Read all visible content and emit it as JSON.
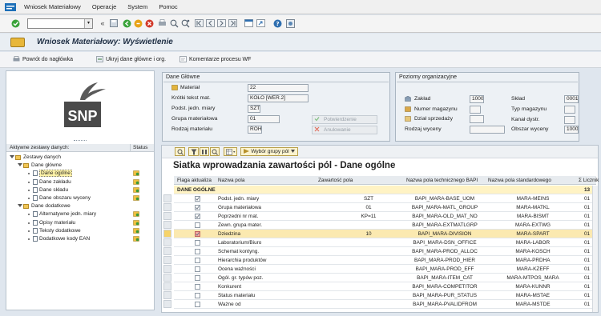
{
  "menu": [
    "Wniosek Materiałowy",
    "Operacje",
    "System",
    "Pomoc"
  ],
  "window_title": "Wniosek Materiałowy: Wyświetlenie",
  "app_toolbar": {
    "back": "Powrót do nagłówka",
    "hide": "Ukryj dane główne i org.",
    "comments": "Komentarze procesu WF"
  },
  "left": {
    "logo_text": "SNP",
    "tree_header": "Aktywne zestawy danych:",
    "status_header": "Status",
    "tree": [
      {
        "label": "Zestawy danych",
        "level": 0,
        "type": "folder"
      },
      {
        "label": "Dane główne",
        "level": 1,
        "type": "folder"
      },
      {
        "label": "Dane ogólne",
        "level": 2,
        "type": "doc",
        "status": true,
        "selected": true
      },
      {
        "label": "Dane zakładu",
        "level": 2,
        "type": "doc",
        "status": true
      },
      {
        "label": "Dane składu",
        "level": 2,
        "type": "doc",
        "status": true
      },
      {
        "label": "Dane obszaru wyceny",
        "level": 2,
        "type": "doc",
        "status": true
      },
      {
        "label": "Dane dodatkowe",
        "level": 1,
        "type": "folder"
      },
      {
        "label": "Alternatywne jedn. miary",
        "level": 2,
        "type": "doc",
        "status": true
      },
      {
        "label": "Opisy materiału",
        "level": 2,
        "type": "doc",
        "status": true
      },
      {
        "label": "Teksty dodatkowe",
        "level": 2,
        "type": "doc",
        "status": true
      },
      {
        "label": "Dodatkowe kody EAN",
        "level": 2,
        "type": "doc",
        "status": true
      }
    ]
  },
  "main_data": {
    "title": "Dane Główne",
    "material_label": "Materiał",
    "material_value": "22",
    "short_text_label": "Krótki tekst mat.",
    "short_text_value": "KOŁO [WER.2]",
    "base_uom_label": "Podst. jedn. miary",
    "base_uom_value": "SZT",
    "mat_group_label": "Grupa materiałowa",
    "mat_group_value": "01",
    "mat_type_label": "Rodzaj materiału",
    "mat_type_value": "ROH",
    "confirm_btn": "Potwierdzenie",
    "cancel_btn": "Anulowanie"
  },
  "org_levels": {
    "title": "Poziomy organizacyjne",
    "plant_label": "Zakład",
    "plant_value": "1000",
    "storage_label": "Skład",
    "storage_value": "0001",
    "warehouse_label": "Numer magazynu",
    "warehouse_type_label": "Typ magazynu",
    "sales_org_label": "Dział sprzedaży",
    "dist_channel_label": "Kanał dystr.",
    "valuation_type_label": "Rodzaj wyceny",
    "valuation_area_label": "Obszar wyceny",
    "valuation_area_value": "1000"
  },
  "grid": {
    "select_group_btn": "Wybór grupy pól",
    "title": "Siatka wprowadzania zawartości pól - Dane ogólne",
    "columns": [
      "Flaga aktualiza",
      "Nazwa pola",
      "Zawartość pola",
      "Nazwa pola technicznego BAPI",
      "Nazwa pola standardowego",
      "Σ Licznik"
    ],
    "group_row": {
      "label": "DANE OGÓLNE",
      "count": "13"
    },
    "rows": [
      {
        "checked": true,
        "field": "Podst. jedn. miary",
        "value": "SZT",
        "bapi": "BAPI_MARA-BASE_UOM",
        "std": "MARA-MEINS",
        "count": "01"
      },
      {
        "checked": true,
        "field": "Grupa materiałowa",
        "value": "01",
        "bapi": "BAPI_MARA-MATL_GROUP",
        "std": "MARA-MATKL",
        "count": "01"
      },
      {
        "checked": true,
        "field": "Poprzedni nr mat.",
        "value": "KP=11",
        "bapi": "BAPI_MARA-OLD_MAT_NO",
        "std": "MARA-BISMT",
        "count": "01"
      },
      {
        "checked": false,
        "field": "Zewn. grupa mater.",
        "value": "",
        "bapi": "BAPI_MARA-EXTMATLGRP",
        "std": "MARA-EXTWG",
        "count": "01"
      },
      {
        "checked": true,
        "field": "Dziedzina",
        "value": "10",
        "bapi": "BAPI_MARA-DIVISION",
        "std": "MARA-SPART",
        "count": "01",
        "highlight": true
      },
      {
        "checked": false,
        "field": "Laboratorium/Biuro",
        "value": "",
        "bapi": "BAPI_MARA-DSN_OFFICE",
        "std": "MARA-LABOR",
        "count": "01"
      },
      {
        "checked": false,
        "field": "Schemat kontyng.",
        "value": "",
        "bapi": "BAPI_MARA-PROD_ALLOC",
        "std": "MARA-KOSCH",
        "count": "01"
      },
      {
        "checked": false,
        "field": "Hierarchia produktów",
        "value": "",
        "bapi": "BAPI_MARA-PROD_HIER",
        "std": "MARA-PRDHA",
        "count": "01"
      },
      {
        "checked": false,
        "field": "Ocena ważności",
        "value": "",
        "bapi": "BAPI_MARA-PROD_EFF",
        "std": "MARA-KZEFF",
        "count": "01"
      },
      {
        "checked": false,
        "field": "Ogól. gr. typów poz.",
        "value": "",
        "bapi": "BAPI_MARA-ITEM_CAT",
        "std": "MARA-MTPOS_MARA",
        "count": "01"
      },
      {
        "checked": false,
        "field": "Konkurent",
        "value": "",
        "bapi": "BAPI_MARA-COMPETITOR",
        "std": "MARA-KUNNR",
        "count": "01"
      },
      {
        "checked": false,
        "field": "Status materiału",
        "value": "",
        "bapi": "BAPI_MARA-PUR_STATUS",
        "std": "MARA-MSTAE",
        "count": "01"
      },
      {
        "checked": false,
        "field": "Ważne od",
        "value": "",
        "bapi": "BAPI_MARA-PVALIDFROM",
        "std": "MARA-MSTDE",
        "count": "01"
      }
    ]
  }
}
